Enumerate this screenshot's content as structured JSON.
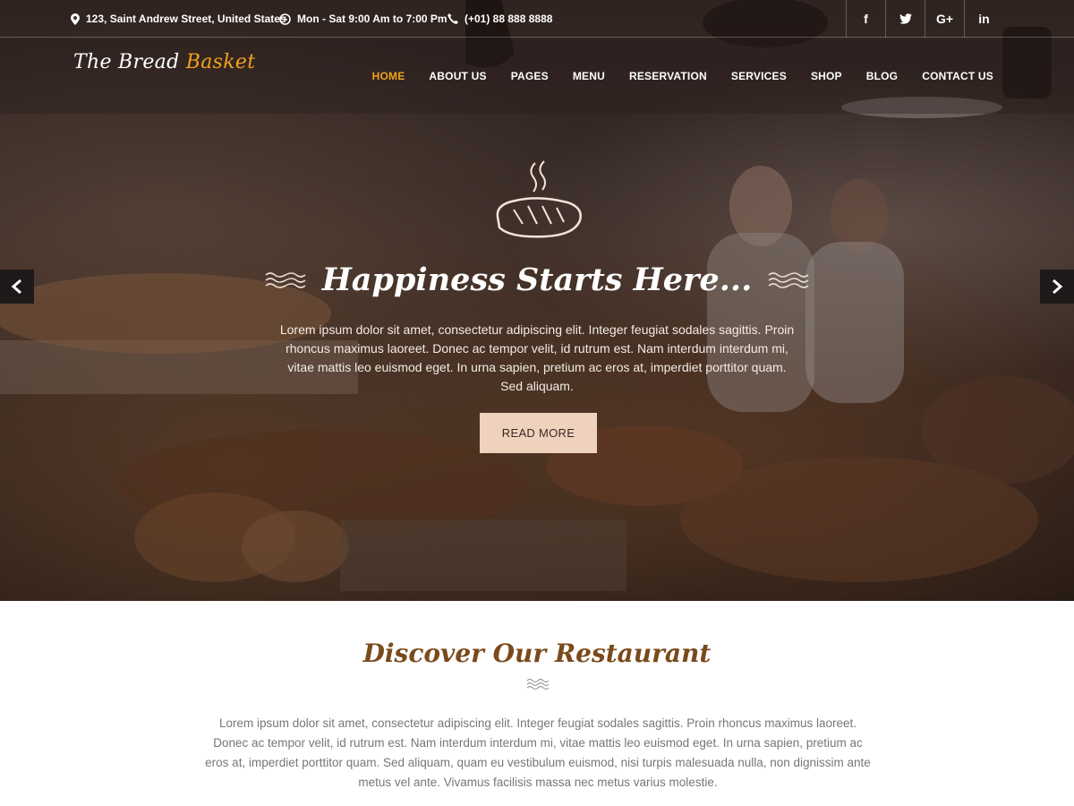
{
  "colors": {
    "accent": "#f0a21a",
    "button_bg": "#efd2bd",
    "heading_brown": "#7a4a1c"
  },
  "topbar": {
    "address": "123, Saint Andrew Street, United States",
    "hours": "Mon - Sat 9:00 Am to 7:00 Pm",
    "phone": "(+01) 88 888 8888",
    "socials": [
      "f",
      "t",
      "G+",
      "in"
    ]
  },
  "logo": {
    "part1": "The Bread ",
    "part2": "Basket"
  },
  "nav": [
    "HOME",
    "ABOUT US",
    "PAGES",
    "MENU",
    "RESERVATION",
    "SERVICES",
    "SHOP",
    "BLOG",
    "CONTACT US"
  ],
  "hero": {
    "title": "Happiness Starts Here...",
    "text": "Lorem ipsum dolor sit amet, consectetur adipiscing elit. Integer feugiat sodales sagittis. Proin rhoncus maximus laoreet. Donec ac tempor velit, id rutrum est. Nam interdum interdum mi, vitae mattis leo euismod eget. In urna sapien, pretium ac eros at, imperdiet porttitor quam. Sed aliquam.",
    "button": "READ MORE"
  },
  "discover": {
    "title": "Discover Our Restaurant",
    "text": "Lorem ipsum dolor sit amet, consectetur adipiscing elit. Integer feugiat sodales sagittis. Proin rhoncus maximus laoreet. Donec ac tempor velit, id rutrum est. Nam interdum interdum mi, vitae mattis leo euismod eget. In urna sapien, pretium ac eros at, imperdiet porttitor quam. Sed aliquam, quam eu vestibulum euismod, nisi turpis malesuada nulla, non dignissim ante metus vel ante. Vivamus facilisis massa nec metus varius molestie."
  }
}
